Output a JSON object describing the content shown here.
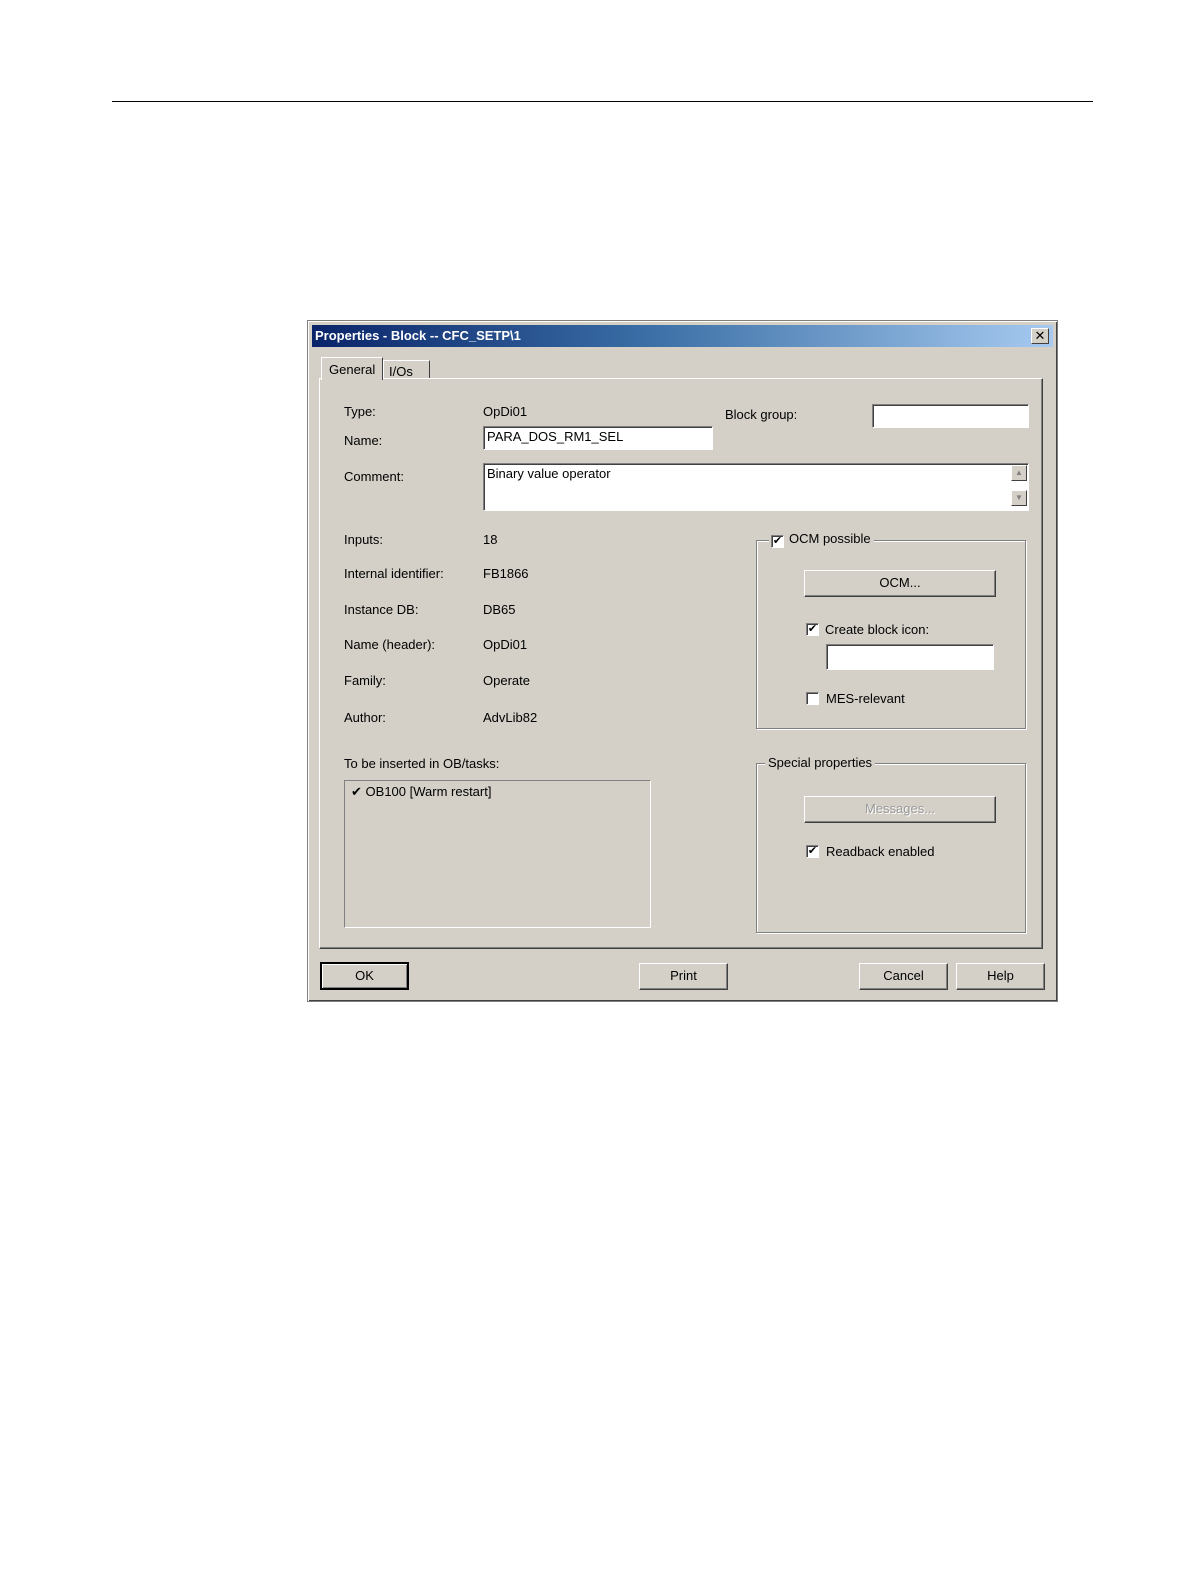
{
  "dialog": {
    "title": "Properties - Block -- CFC_SETP\\1",
    "close_glyph": "✕"
  },
  "tabs": [
    {
      "label": "General",
      "active": true
    },
    {
      "label": "I/Os",
      "active": false
    }
  ],
  "general": {
    "type_label": "Type:",
    "type_value": "OpDi01",
    "name_label": "Name:",
    "name_value": "PARA_DOS_RM1_SEL",
    "comment_label": "Comment:",
    "comment_value": "Binary value operator",
    "block_group_label": "Block group:",
    "block_group_value": "",
    "inputs_label": "Inputs:",
    "inputs_value": "18",
    "internal_id_label": "Internal identifier:",
    "internal_id_value": "FB1866",
    "instance_db_label": "Instance DB:",
    "instance_db_value": "DB65",
    "name_header_label": "Name (header):",
    "name_header_value": "OpDi01",
    "family_label": "Family:",
    "family_value": "Operate",
    "author_label": "Author:",
    "author_value": "AdvLib82",
    "ob_tasks_label": "To be inserted in OB/tasks:",
    "ob_tasks_items": [
      {
        "check": "✔",
        "label": "OB100 [Warm restart]"
      }
    ]
  },
  "ocm_group": {
    "ocm_possible_label": "OCM possible",
    "ocm_possible_checked": true,
    "ocm_button": "OCM...",
    "create_block_icon_label": "Create block icon:",
    "create_block_icon_checked": true,
    "block_icon_value": "",
    "mes_relevant_label": "MES-relevant",
    "mes_relevant_checked": false
  },
  "special_group": {
    "legend": "Special properties",
    "messages_button": "Messages...",
    "readback_label": "Readback enabled",
    "readback_checked": true
  },
  "footer": {
    "ok": "OK",
    "print": "Print",
    "cancel": "Cancel",
    "help": "Help"
  },
  "glyphs": {
    "check": "✔",
    "scroll_up": "▲",
    "scroll_down": "▼"
  }
}
